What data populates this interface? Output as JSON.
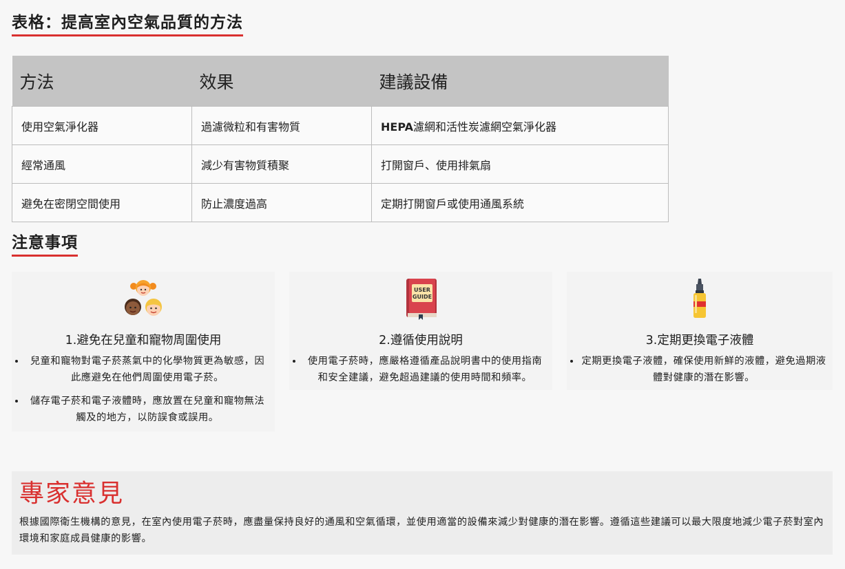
{
  "table_section": {
    "title": "表格：提高室內空氣品質的方法",
    "headers": [
      "方法",
      "效果",
      "建議設備"
    ],
    "rows": [
      {
        "method": "使用空氣淨化器",
        "effect": "過濾微粒和有害物質",
        "device_bold": "HEPA",
        "device_rest": "濾網和活性炭濾網空氣淨化器"
      },
      {
        "method": "經常通風",
        "effect": "減少有害物質積聚",
        "device_bold": "",
        "device_rest": "打開窗戶、使用排氣扇"
      },
      {
        "method": "避免在密閉空間使用",
        "effect": "防止濃度過高",
        "device_bold": "",
        "device_rest": "定期打開窗戶或使用通風系統"
      }
    ]
  },
  "notes_section": {
    "title": "注意事項",
    "cards": [
      {
        "icon": "children-icon",
        "title": "1.避免在兒童和寵物周圍使用",
        "bullets": [
          "兒童和寵物對電子菸蒸氣中的化學物質更為敏感，因此應避免在他們周圍使用電子菸。",
          "儲存電子菸和電子液體時，應放置在兒童和寵物無法觸及的地方，以防誤食或誤用。"
        ]
      },
      {
        "icon": "user-guide-book-icon",
        "icon_text_line1": "USER",
        "icon_text_line2": "GUIDE",
        "title": "2.遵循使用說明",
        "bullets": [
          "使用電子菸時，應嚴格遵循產品說明書中的使用指南和安全建議，避免超過建議的使用時間和頻率。"
        ]
      },
      {
        "icon": "e-liquid-bottle-icon",
        "title": "3.定期更換電子液體",
        "bullets": [
          "定期更換電子液體，確保使用新鮮的液體，避免過期液體對健康的潛在影響。"
        ]
      }
    ]
  },
  "expert_section": {
    "title": "專家意見",
    "text": "根據國際衛生機構的意見，在室內使用電子菸時，應盡量保持良好的通風和空氣循環，並使用適當的設備來減少對健康的潛在影響。遵循這些建議可以最大限度地減少電子菸對室內環境和家庭成員健康的影響。"
  },
  "colors": {
    "accent_red": "#d9302f",
    "table_header_bg": "#c4c4c4"
  }
}
